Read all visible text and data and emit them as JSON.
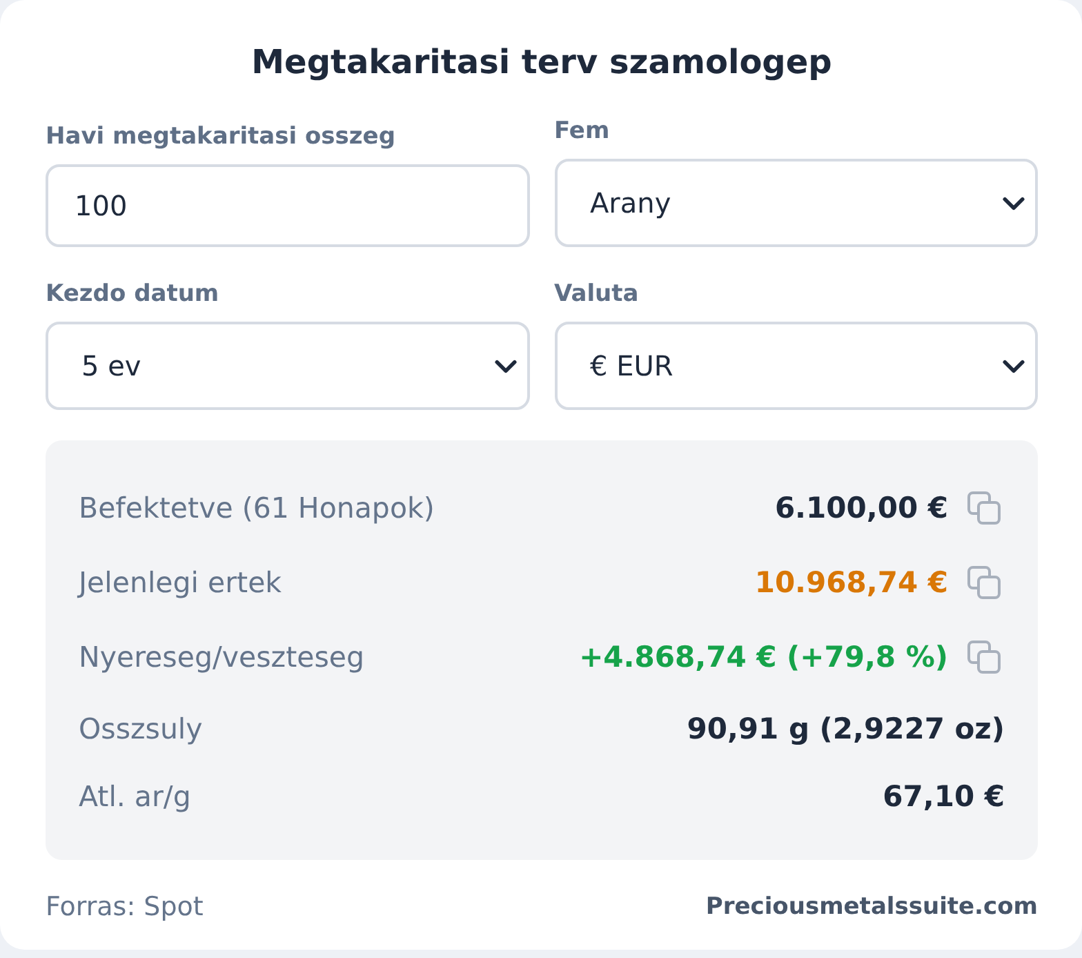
{
  "title": "Megtakaritasi terv szamologep",
  "fields": [
    {
      "kind": "input",
      "label": "Havi megtakaritasi osszeg",
      "value": "100"
    },
    {
      "kind": "select",
      "label": "Fem",
      "value": "Arany"
    },
    {
      "kind": "select",
      "label": "Kezdo datum",
      "value": "5 ev"
    },
    {
      "kind": "select",
      "label": "Valuta",
      "value": "€ EUR"
    }
  ],
  "results": [
    {
      "label": "Befektetve (61 Honapok)",
      "value": "6.100,00 €",
      "color": "#1e293b",
      "copyable": true
    },
    {
      "label": "Jelenlegi ertek",
      "value": "10.968,74 €",
      "color": "#d97706",
      "copyable": true
    },
    {
      "label": "Nyereseg/veszteseg",
      "value": "+4.868,74 € (+79,8 %)",
      "color": "#16a34a",
      "copyable": true
    },
    {
      "label": "Osszsuly",
      "value": "90,91 g (2,9227 oz)",
      "color": "#1e293b",
      "copyable": false
    },
    {
      "label": "Atl. ar/g",
      "value": "67,10 €",
      "color": "#1e293b",
      "copyable": false
    }
  ],
  "footer": {
    "source": "Forras: Spot",
    "site": "Preciousmetalssuite.com"
  }
}
